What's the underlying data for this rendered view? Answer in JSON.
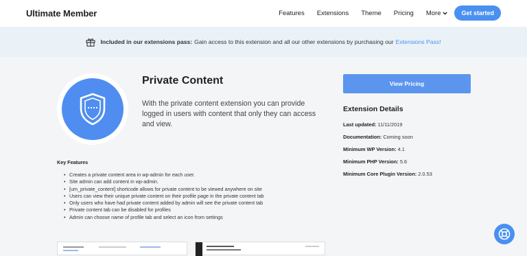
{
  "header": {
    "logo": "Ultimate Member",
    "nav": [
      "Features",
      "Extensions",
      "Theme",
      "Pricing"
    ],
    "more_label": "More",
    "cta_label": "Get started"
  },
  "banner": {
    "bold": "Included in our extensions pass:",
    "text": "Gain access to this extension and all our other extensions by purchasing our",
    "link": "Extensions Pass!"
  },
  "extension": {
    "title": "Private Content",
    "description": "With the private content extension you can provide logged in users with content that only they can access and view."
  },
  "features": {
    "heading": "Key Features",
    "items": [
      "Creates a private content area in wp-admin for each user.",
      "Site admin can add content in wp-admin.",
      "[um_private_content] shortcode allows for private content to be viewed anywhere on site",
      "Users can view their unique private content on their profile page in the private content tab",
      "Only users who have had private content added by admin will see the private content tab",
      "Private content tab can be disabled for profiles",
      "Admin can choose name of profile tab and select an icon from settings"
    ]
  },
  "sidebar": {
    "pricing_label": "View Pricing",
    "details_heading": "Extension Details",
    "details": [
      {
        "label": "Last updated:",
        "value": "11/11/2019"
      },
      {
        "label": "Documentation:",
        "value": "Coming soon"
      },
      {
        "label": "Minimum WP Version:",
        "value": "4.1"
      },
      {
        "label": "Minimum PHP Version:",
        "value": "5.6"
      },
      {
        "label": "Minimum Core Plugin Version:",
        "value": "2.0.53"
      }
    ]
  },
  "colors": {
    "accent": "#4a90f0",
    "banner_bg": "#eaf2f8",
    "page_bg": "#f4f5f7"
  },
  "icons": {
    "banner": "gift-icon",
    "badge": "shield-icon",
    "nav_more": "chevron-down-icon",
    "help": "lifebuoy-icon"
  }
}
